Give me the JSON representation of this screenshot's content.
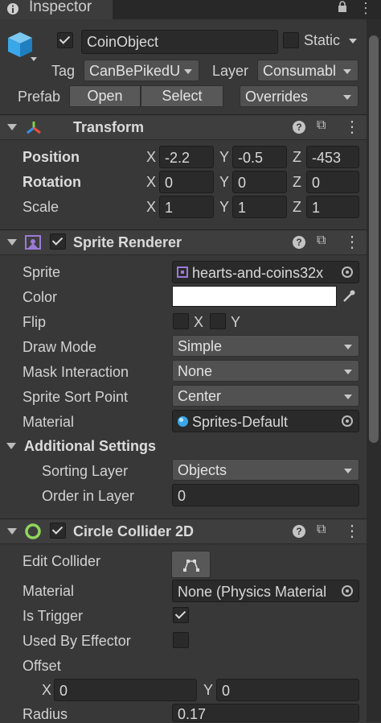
{
  "tab": {
    "label": "Inspector"
  },
  "object": {
    "name": "CoinObject",
    "static_label": "Static",
    "tag_label": "Tag",
    "tag_value": "CanBePikedU",
    "layer_label": "Layer",
    "layer_value": "Consumabl",
    "prefab_label": "Prefab",
    "open_label": "Open",
    "select_label": "Select",
    "overrides_label": "Overrides"
  },
  "transform": {
    "title": "Transform",
    "position_label": "Position",
    "rotation_label": "Rotation",
    "scale_label": "Scale",
    "position": {
      "x": "-2.2",
      "y": "-0.5",
      "z": "-453"
    },
    "rotation": {
      "x": "0",
      "y": "0",
      "z": "0"
    },
    "scale": {
      "x": "1",
      "y": "1",
      "z": "1"
    }
  },
  "axes": {
    "x": "X",
    "y": "Y",
    "z": "Z"
  },
  "sprite_renderer": {
    "title": "Sprite Renderer",
    "sprite_label": "Sprite",
    "sprite_value": "hearts-and-coins32x",
    "color_label": "Color",
    "color_value": "#ffffff",
    "flip_label": "Flip",
    "flip_x": "X",
    "flip_y": "Y",
    "draw_mode_label": "Draw Mode",
    "draw_mode_value": "Simple",
    "mask_label": "Mask Interaction",
    "mask_value": "None",
    "sort_point_label": "Sprite Sort Point",
    "sort_point_value": "Center",
    "material_label": "Material",
    "material_value": "Sprites-Default",
    "additional_title": "Additional Settings",
    "sorting_layer_label": "Sorting Layer",
    "sorting_layer_value": "Objects",
    "order_label": "Order in Layer",
    "order_value": "0"
  },
  "circle_collider": {
    "title": "Circle Collider 2D",
    "edit_label": "Edit Collider",
    "material_label": "Material",
    "material_value": "None (Physics Material",
    "trigger_label": "Is Trigger",
    "effector_label": "Used By Effector",
    "offset_label": "Offset",
    "offset_x": "0",
    "offset_y": "0",
    "radius_label": "Radius",
    "radius_value": "0.17"
  },
  "colors": {
    "accent_green": "#8fd65a",
    "purple_icon": "#9b7ad8",
    "cube_blue": "#3aa7e8"
  }
}
